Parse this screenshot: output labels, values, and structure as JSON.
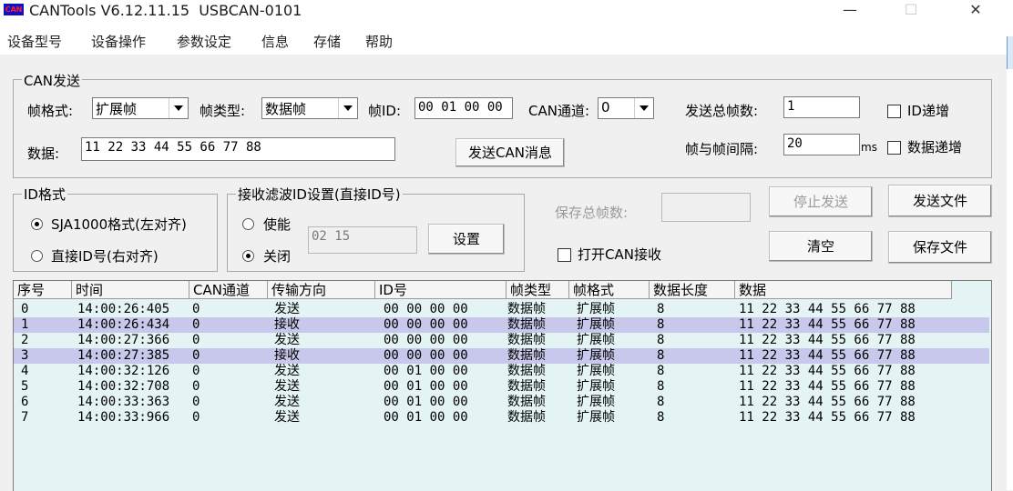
{
  "window": {
    "title": "CANTools V6.12.11.15  USBCAN-0101",
    "icon_text": "CAN",
    "minimize": "—",
    "maximize": "☐",
    "close": "✕"
  },
  "menu": [
    "设备型号",
    "设备操作",
    "参数设定",
    "信息",
    "存储",
    "帮助"
  ],
  "send_group": {
    "title": "CAN发送",
    "frame_format_label": "帧格式:",
    "frame_format_value": "扩展帧",
    "frame_type_label": "帧类型:",
    "frame_type_value": "数据帧",
    "frame_id_label": "帧ID:",
    "frame_id_value": "00 01 00 00",
    "channel_label": "CAN通道:",
    "channel_value": "0",
    "total_frames_label": "发送总帧数:",
    "total_frames_value": "1",
    "id_increment_label": "ID递增",
    "data_label": "数据:",
    "data_value": "11 22 33 44 55 66 77 88",
    "send_button": "发送CAN消息",
    "interval_label": "帧与帧间隔:",
    "interval_value": "20",
    "interval_unit": "ms",
    "data_increment_label": "数据递增"
  },
  "id_format_group": {
    "title": "ID格式",
    "option1": "SJA1000格式(左对齐)",
    "option2": "直接ID号(右对齐)"
  },
  "filter_group": {
    "title": "接收滤波ID设置(直接ID号)",
    "enable": "使能",
    "disable": "关闭",
    "filter_value": "02 15",
    "set_button": "设置"
  },
  "save_total_label": "保存总帧数:",
  "open_receive_label": "打开CAN接收",
  "buttons": {
    "stop_send": "停止发送",
    "send_file": "发送文件",
    "clear": "清空",
    "save_file": "保存文件"
  },
  "table": {
    "headers": [
      "序号",
      "时间",
      "CAN通道",
      "传输方向",
      "ID号",
      "帧类型",
      "帧格式",
      "数据长度",
      "数据"
    ],
    "rows": [
      [
        "0",
        "14:00:26:405",
        "0",
        "发送",
        "00 00 00 00",
        "数据帧",
        "扩展帧",
        "8",
        "11 22 33 44 55 66 77 88"
      ],
      [
        "1",
        "14:00:26:434",
        "0",
        "接收",
        "00 00 00 00",
        "数据帧",
        "扩展帧",
        "8",
        "11 22 33 44 55 66 77 88"
      ],
      [
        "2",
        "14:00:27:366",
        "0",
        "发送",
        "00 00 00 00",
        "数据帧",
        "扩展帧",
        "8",
        "11 22 33 44 55 66 77 88"
      ],
      [
        "3",
        "14:00:27:385",
        "0",
        "接收",
        "00 00 00 00",
        "数据帧",
        "扩展帧",
        "8",
        "11 22 33 44 55 66 77 88"
      ],
      [
        "4",
        "14:00:32:126",
        "0",
        "发送",
        "00 01 00 00",
        "数据帧",
        "扩展帧",
        "8",
        "11 22 33 44 55 66 77 88"
      ],
      [
        "5",
        "14:00:32:708",
        "0",
        "发送",
        "00 01 00 00",
        "数据帧",
        "扩展帧",
        "8",
        "11 22 33 44 55 66 77 88"
      ],
      [
        "6",
        "14:00:33:363",
        "0",
        "发送",
        "00 01 00 00",
        "数据帧",
        "扩展帧",
        "8",
        "11 22 33 44 55 66 77 88"
      ],
      [
        "7",
        "14:00:33:966",
        "0",
        "发送",
        "00 01 00 00",
        "数据帧",
        "扩展帧",
        "8",
        "11 22 33 44 55 66 77 88"
      ]
    ]
  }
}
